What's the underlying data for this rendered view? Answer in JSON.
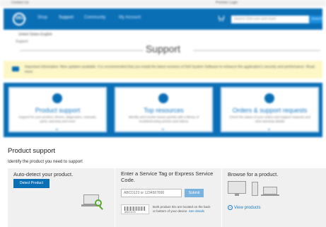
{
  "topbar": {
    "left_text": "Contact Us",
    "right_text": "Premier Login"
  },
  "nav": {
    "logo_text": "DELL",
    "items": [
      {
        "label": "Shop"
      },
      {
        "label": "Support"
      },
      {
        "label": "Community"
      },
      {
        "label": "My Account"
      }
    ],
    "search_placeholder": "Search Dell.com and more",
    "search_button": "Search"
  },
  "breadcrumb": {
    "line1": "United States   English",
    "line2": "Support"
  },
  "page_title": "Support",
  "notice": {
    "text": "Important information: New updates available. It is recommended that you install the latest versions of Dell System Software to enhance the application's security and performance. Read more"
  },
  "cards": [
    {
      "title": "Product support",
      "desc": "Support for your product: drivers, diagnostics, manuals, parts, warranty and more"
    },
    {
      "title": "Top resources",
      "desc": "Identify and resolve issues quickly with a library of troubleshooting articles and videos"
    },
    {
      "title": "Orders & support requests",
      "desc": "Check the status of your orders and support requests and view warranty details"
    }
  ],
  "product_support": {
    "title": "Product support",
    "subtitle": "Identify the product you need to support",
    "auto_detect": {
      "title": "Auto-detect your product.",
      "button": "Detect Product"
    },
    "service_tag": {
      "title": "Enter a Service Tag or Express Service Code.",
      "placeholder": "ABCD123 or 1234567890",
      "button": "Submit",
      "barcode_number": "ABCD123",
      "help_text": "Both product IDs are located on the back or bottom of your device.",
      "help_link": "See details"
    },
    "browse": {
      "title": "Browse for a product.",
      "link": "View products"
    }
  },
  "colors": {
    "brand_blue": "#0b6fb6",
    "notice_yellow": "#fdf7c7",
    "panel_gray": "#f0f0f0",
    "magnifier_green": "#5aa832"
  }
}
